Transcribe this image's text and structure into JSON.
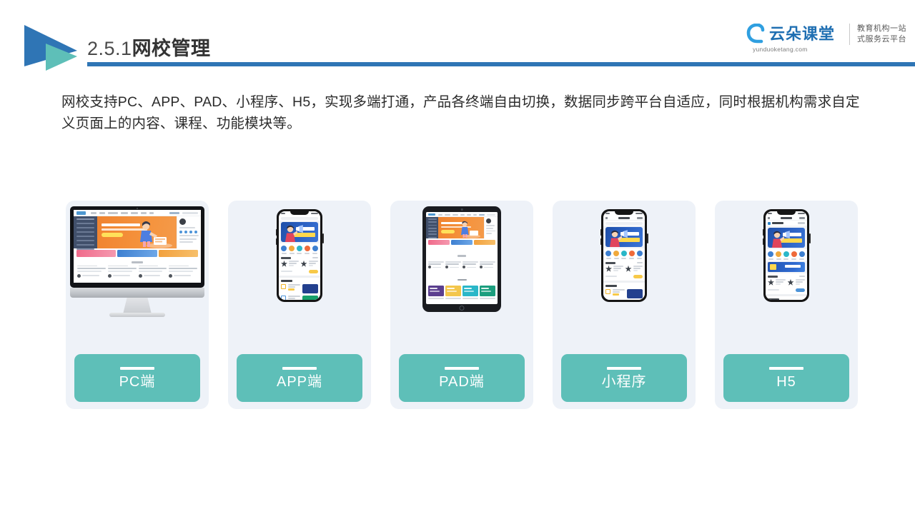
{
  "header": {
    "section_number": "2.5.1",
    "title_cn": "网校管理",
    "rule_color": "#2f75b5",
    "logo_icon": "play-triangle-logo",
    "brand": {
      "name": "云朵课堂",
      "url": "yunduoketang.com",
      "tagline_line1": "教育机构一站",
      "tagline_line2": "式服务云平台",
      "color": "#1f6fb2"
    }
  },
  "body": {
    "paragraph": "网校支持PC、APP、PAD、小程序、H5，实现多端打通，产品各终端自由切换，数据同步跨平台自适应，同时根据机构需求自定义页面上的内容、课程、功能模块等。"
  },
  "cards": {
    "accent_color": "#5ebfb8",
    "card_bg": "#eef2f8",
    "items": [
      {
        "label": "PC端",
        "device": "desktop-monitor"
      },
      {
        "label": "APP端",
        "device": "smartphone"
      },
      {
        "label": "PAD端",
        "device": "tablet"
      },
      {
        "label": "小程序",
        "device": "smartphone"
      },
      {
        "label": "H5",
        "device": "smartphone"
      }
    ]
  },
  "mock_ui": {
    "hero_banner_color": "#f0832f",
    "app_banner_color": "#2a5fc0",
    "sidebar_color": "#41506b",
    "thumb_colors": [
      "#e8738f",
      "#3d7fd0",
      "#f2a03d"
    ],
    "tablet_thumb_colors": [
      "#e8738f",
      "#3d7fd0",
      "#f2a03d"
    ],
    "grid_colors_row1": [
      "#5b3f8f",
      "#f3c64b",
      "#2ab7c8",
      "#1c9e7e"
    ],
    "grid_colors_row2": [
      "#23408e",
      "#ef7a33",
      "#2a6fd0",
      "#2ab7c8"
    ],
    "grid_colors_row3": [
      "#f3c64b",
      "#2a5fc0",
      "#1c9e7e",
      "#ef7a33"
    ],
    "app_icon_colors": [
      "#3d7fd0",
      "#f0a93c",
      "#2ab7c8",
      "#ef6a3a",
      "#3d7fd0"
    ],
    "twocol_colors": [
      "#23408e",
      "#17a06b"
    ]
  }
}
